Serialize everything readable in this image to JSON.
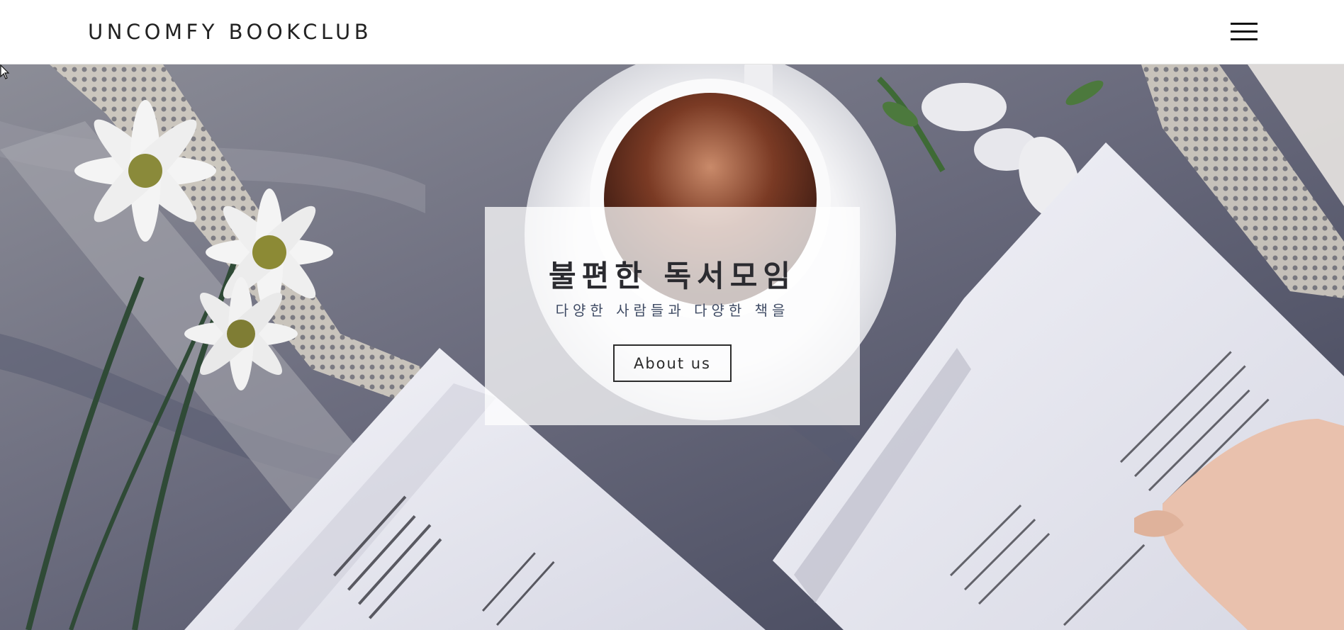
{
  "header": {
    "brand": "UNCOMFY BOOKCLUB",
    "menu_icon": "hamburger-menu-icon"
  },
  "hero": {
    "title": "불편한 독서모임",
    "subtitle": "다양한 사람들과 다양한 책을",
    "button_label": "About us",
    "background_image": "coffee cup, white daisies, lace and open books on grey fabric"
  },
  "colors": {
    "navbar_bg": "#ffffff",
    "brand_text": "#222222",
    "panel_bg": "rgba(255,255,255,0.74)",
    "title_text": "#2b2b30",
    "subtitle_text": "#3e4a63",
    "button_border": "#2c2c2c"
  }
}
